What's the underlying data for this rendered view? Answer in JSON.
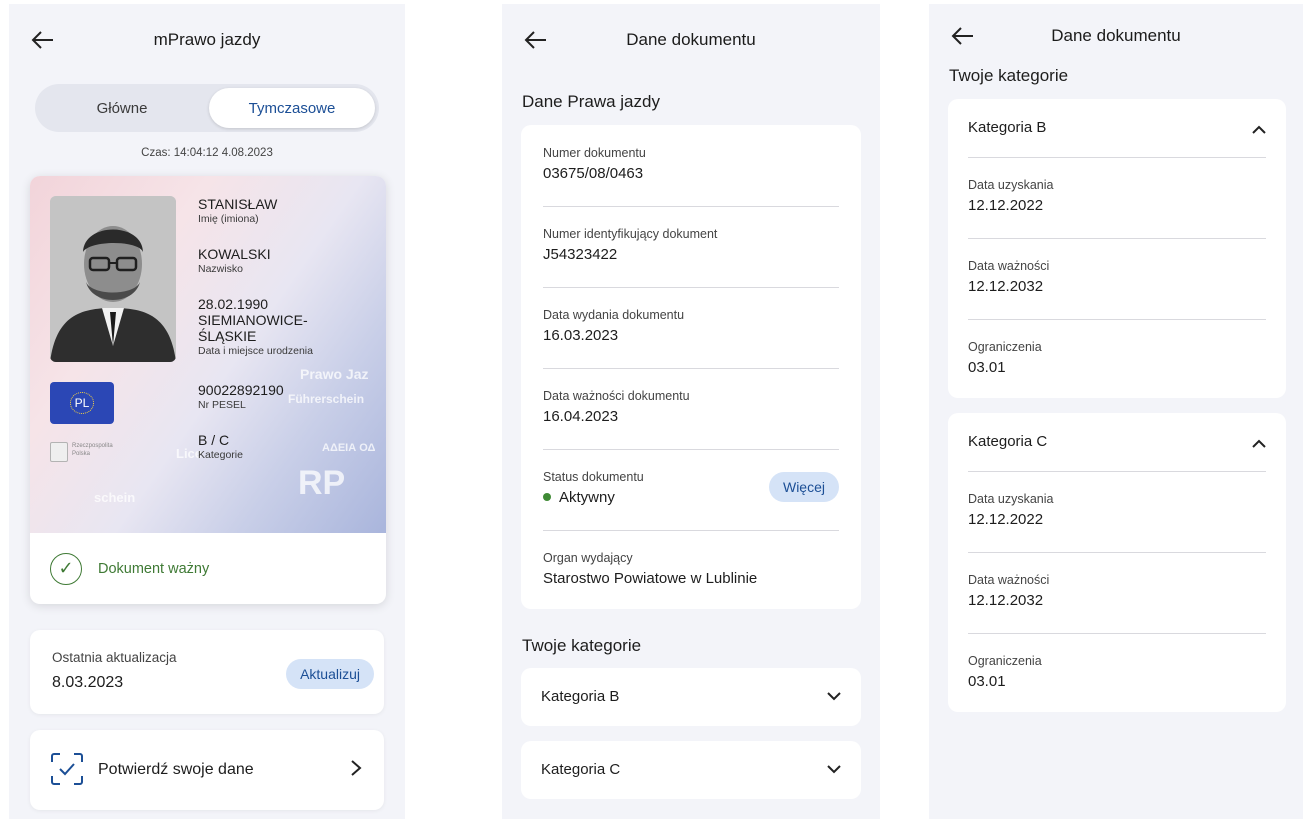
{
  "screen1": {
    "title": "mPrawo jazdy",
    "segments": {
      "main": "Główne",
      "temporary": "Tymczasowe"
    },
    "timestamp": "Czas: 14:04:12 4.08.2023",
    "card": {
      "first_name": "STANISŁAW",
      "first_name_label": "Imię (imiona)",
      "last_name": "KOWALSKI",
      "last_name_label": "Nazwisko",
      "birth_date": "28.02.1990",
      "birth_place_line1": "SIEMIANOWICE-",
      "birth_place_line2": "ŚLĄSKIE",
      "birth_label": "Data i miejsce urodzenia",
      "pesel": "90022892190",
      "pesel_label": "Nr PESEL",
      "categories": "B / C",
      "categories_label": "Kategorie",
      "flag_text": "PL",
      "issuer_line1": "Rzeczpospolita",
      "issuer_line2": "Polska",
      "wm_prawo": "Prawo Jaz",
      "wm_fuhrer": "Führerschein",
      "wm_adeia": "ΑΔΕΙΑ ΟΔ",
      "wm_licence": "Lice",
      "wm_schein": "schein",
      "wm_rp": "RP",
      "status": "Dokument ważny"
    },
    "update": {
      "label": "Ostatnia aktualizacja",
      "date": "8.03.2023",
      "button": "Aktualizuj"
    },
    "confirm": {
      "label": "Potwierdź swoje dane"
    }
  },
  "screen2": {
    "title": "Dane dokumentu",
    "section_title": "Dane Prawa jazdy",
    "fields": [
      {
        "label": "Numer dokumentu",
        "value": "03675/08/0463"
      },
      {
        "label": "Numer identyfikujący dokument",
        "value": "J54323422"
      },
      {
        "label": "Data wydania dokumentu",
        "value": "16.03.2023"
      },
      {
        "label": "Data ważności dokumentu",
        "value": "16.04.2023"
      },
      {
        "label": "Status dokumentu",
        "value": "Aktywny"
      },
      {
        "label": "Organ wydający",
        "value": "Starostwo Powiatowe w Lublinie"
      }
    ],
    "more_button": "Więcej",
    "categories_title": "Twoje kategorie",
    "categories": [
      "Kategoria B",
      "Kategoria C"
    ]
  },
  "screen3": {
    "title": "Dane dokumentu",
    "section_title": "Twoje kategorie",
    "categories": [
      {
        "name": "Kategoria B",
        "fields": [
          {
            "label": "Data uzyskania",
            "value": "12.12.2022"
          },
          {
            "label": "Data ważności",
            "value": "12.12.2032"
          },
          {
            "label": "Ograniczenia",
            "value": "03.01"
          }
        ]
      },
      {
        "name": "Kategoria C",
        "fields": [
          {
            "label": "Data uzyskania",
            "value": "12.12.2022"
          },
          {
            "label": "Data ważności",
            "value": "12.12.2032"
          },
          {
            "label": "Ograniczenia",
            "value": "03.01"
          }
        ]
      }
    ]
  },
  "colors": {
    "accent_blue": "#1c4f96",
    "valid_green": "#3f7a35",
    "pill_bg": "#d5e3f7",
    "screen_bg": "#f3f4f9"
  },
  "icons": [
    "arrow-left-icon",
    "check-circle-icon",
    "scan-check-icon",
    "chevron-right-icon",
    "chevron-down-icon",
    "chevron-up-icon",
    "eu-flag-icon",
    "eagle-emblem-icon"
  ]
}
